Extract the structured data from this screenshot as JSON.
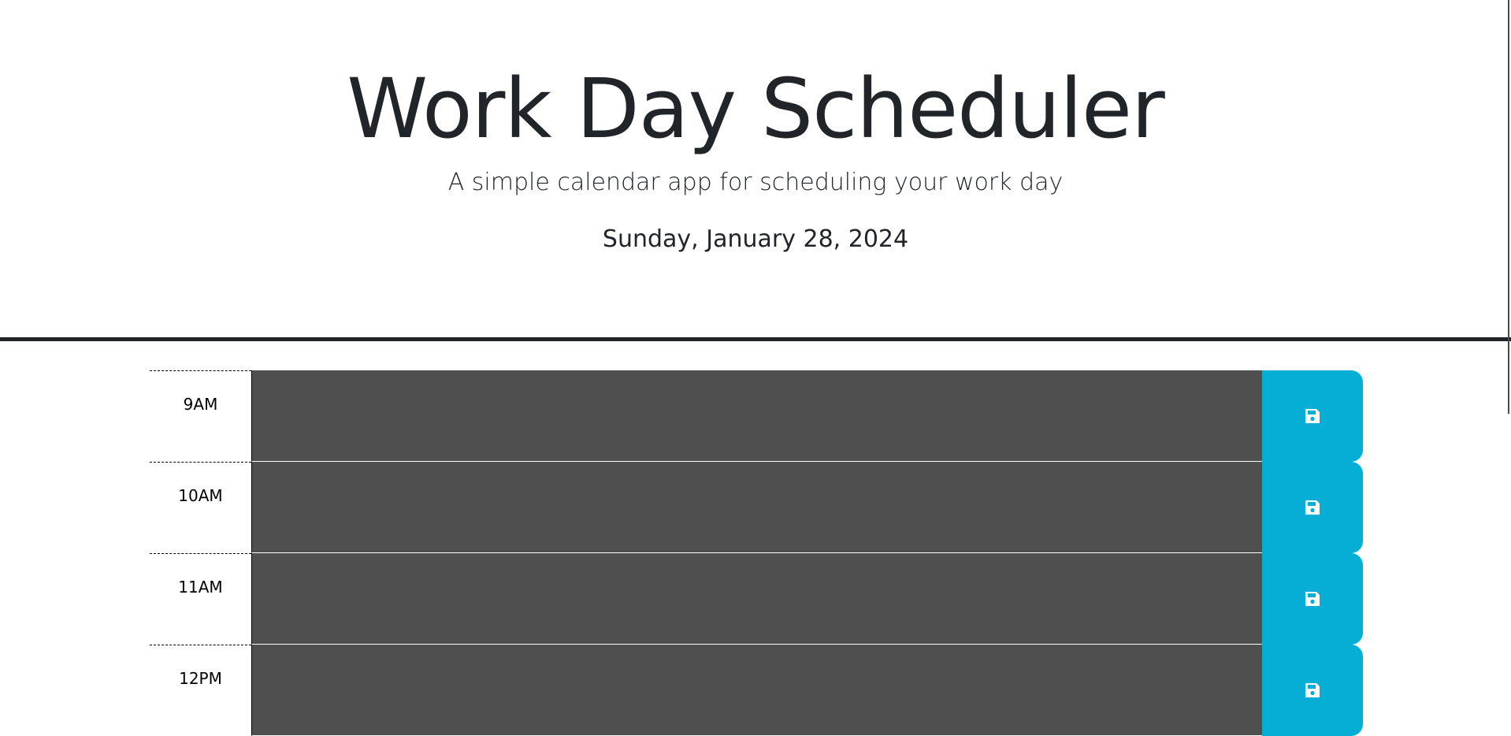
{
  "header": {
    "title": "Work Day Scheduler",
    "subtitle": "A simple calendar app for scheduling your work day",
    "current_date": "Sunday, January 28, 2024"
  },
  "colors": {
    "save_button": "#06aed5",
    "past_block": "#4f4f4f"
  },
  "schedule": {
    "save_icon": "floppy-disk-icon",
    "rows": [
      {
        "hour": "9AM",
        "text": ""
      },
      {
        "hour": "10AM",
        "text": ""
      },
      {
        "hour": "11AM",
        "text": ""
      },
      {
        "hour": "12PM",
        "text": ""
      }
    ]
  }
}
